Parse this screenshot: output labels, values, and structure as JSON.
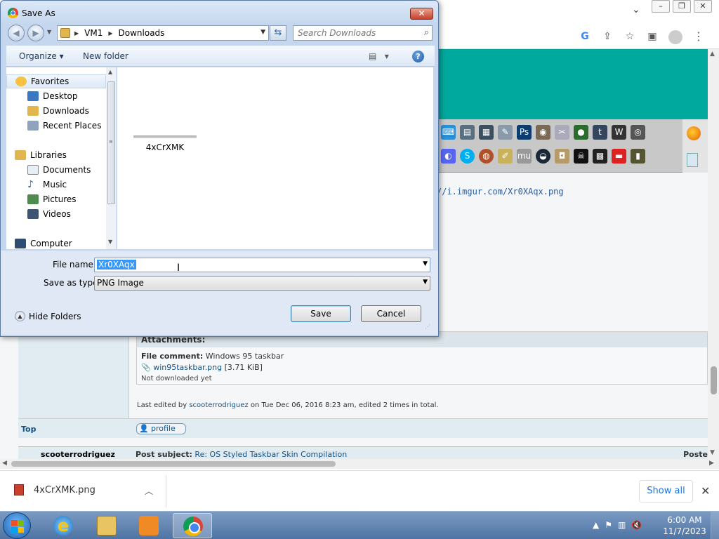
{
  "dialog": {
    "title": "Save As",
    "breadcrumb": [
      "VM1",
      "Downloads"
    ],
    "search_placeholder": "Search Downloads",
    "organize_label": "Organize",
    "new_folder_label": "New folder",
    "nav": {
      "favorites_label": "Favorites",
      "favorites": [
        "Desktop",
        "Downloads",
        "Recent Places"
      ],
      "libraries_label": "Libraries",
      "libraries": [
        "Documents",
        "Music",
        "Pictures",
        "Videos"
      ],
      "computer_label": "Computer"
    },
    "files": [
      {
        "name": "4xCrXMK"
      }
    ],
    "file_name_label": "File name:",
    "file_name_value": "Xr0XAqx",
    "save_type_label": "Save as type:",
    "save_type_value": "PNG Image",
    "hide_folders_label": "Hide Folders",
    "save_label": "Save",
    "cancel_label": "Cancel"
  },
  "page": {
    "url_text": "//i.imgur.com/Xr0XAqx.png",
    "attachments_label": "Attachments:",
    "file_comment_label": "File comment:",
    "file_comment": "Windows 95 taskbar",
    "attachment_file": "win95taskbar.png",
    "attachment_size": "[3.71 KiB]",
    "not_downloaded": "Not downloaded yet",
    "last_edited_prefix": "Last edited by",
    "last_edited_user": "scooterrodriguez",
    "last_edited_suffix": "on Tue Dec 06, 2016 8:23 am, edited 2 times in total.",
    "top_link": "Top",
    "profile_label": "profile",
    "next_author": "scooterrodriguez",
    "next_subject_label": "Post subject:",
    "next_subject": "Re: OS Styled Taskbar Skin Compilation",
    "posted_label": "Poste"
  },
  "downloads": {
    "file": "4xCrXMK.png",
    "show_all": "Show all"
  },
  "taskbar": {
    "time": "6:00 AM",
    "date": "11/7/2023"
  },
  "colors": {
    "teal_banner": "#00a99d",
    "dialog_bg": "#c5d7ee",
    "selection": "#3399ff",
    "link": "#105289"
  }
}
